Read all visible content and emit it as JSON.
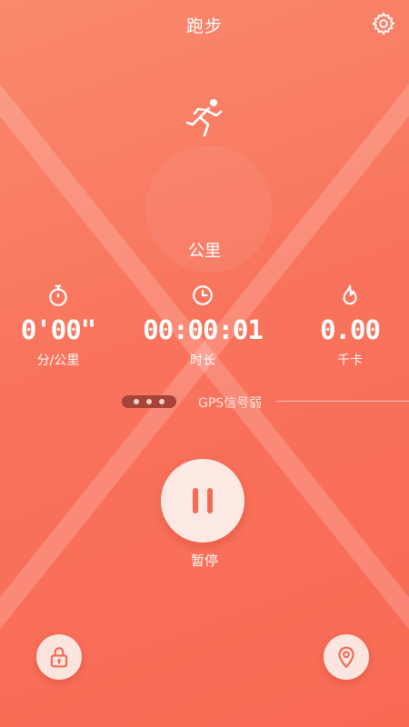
{
  "header": {
    "title": "跑步",
    "settings_icon": "gear-icon"
  },
  "mode_icon": "running-man-icon",
  "distance": {
    "unit": "公里"
  },
  "stats": [
    {
      "icon": "stopwatch-icon",
      "value": "0'00\"",
      "label": "分/公里"
    },
    {
      "icon": "clock-icon",
      "value": "00:00:01",
      "label": "时长"
    },
    {
      "icon": "flame-icon",
      "value": "0.00",
      "label": "千卡"
    }
  ],
  "gps": {
    "text": "GPS信号弱"
  },
  "controls": {
    "pause_label": "暂停",
    "lock_icon": "lock-icon",
    "location_icon": "location-pin-icon"
  },
  "colors": {
    "background": "#f9735c",
    "button_face": "#fde9e3",
    "accent": "#f36b55"
  }
}
